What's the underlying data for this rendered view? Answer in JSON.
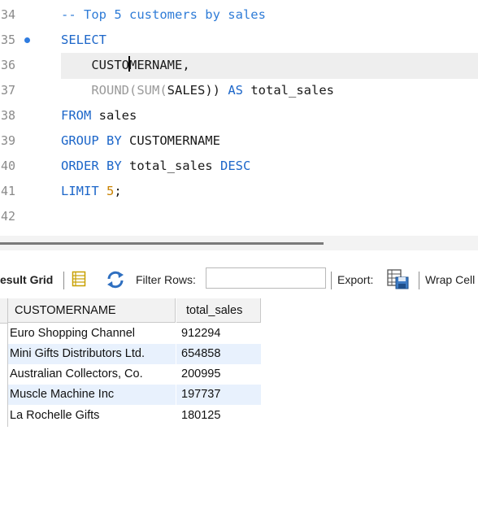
{
  "editor": {
    "lines": [
      {
        "n": "34",
        "tokens": [
          {
            "t": "-- Top 5 customers by sales",
            "c": "cm"
          }
        ]
      },
      {
        "n": "35",
        "bullet": true,
        "tokens": [
          {
            "t": "SELECT",
            "c": "kw"
          }
        ]
      },
      {
        "n": "36",
        "current": true,
        "tokens": [
          {
            "t": "    CUSTO"
          },
          {
            "caret": true
          },
          {
            "t": "MERNAME,"
          }
        ]
      },
      {
        "n": "37",
        "tokens": [
          {
            "t": "    "
          },
          {
            "t": "ROUND(SUM(",
            "c": "fn"
          },
          {
            "t": "SALES"
          },
          {
            "t": "))",
            "c": ""
          },
          {
            "t": " AS ",
            "c": "kw"
          },
          {
            "t": "total_sales"
          }
        ]
      },
      {
        "n": "38",
        "tokens": [
          {
            "t": "FROM",
            "c": "kw"
          },
          {
            "t": " sales"
          }
        ]
      },
      {
        "n": "39",
        "tokens": [
          {
            "t": "GROUP BY",
            "c": "kw"
          },
          {
            "t": " CUSTOMERNAME"
          }
        ]
      },
      {
        "n": "40",
        "tokens": [
          {
            "t": "ORDER BY",
            "c": "kw"
          },
          {
            "t": " total_sales "
          },
          {
            "t": "DESC",
            "c": "kw"
          }
        ]
      },
      {
        "n": "41",
        "tokens": [
          {
            "t": "LIMIT",
            "c": "kw"
          },
          {
            "t": " "
          },
          {
            "t": "5",
            "c": "num"
          },
          {
            "t": ";"
          }
        ]
      },
      {
        "n": "42",
        "tokens": []
      }
    ]
  },
  "toolbar": {
    "result_grid_label": "esult Grid",
    "filter_label": "Filter Rows:",
    "filter_value": "",
    "export_label": "Export:",
    "wrap_label": "Wrap Cell"
  },
  "grid": {
    "columns": [
      "CUSTOMERNAME",
      "total_sales"
    ],
    "rows": [
      [
        "Euro Shopping Channel",
        "912294"
      ],
      [
        "Mini Gifts Distributors Ltd.",
        "654858"
      ],
      [
        "Australian Collectors, Co.",
        "200995"
      ],
      [
        "Muscle Machine Inc",
        "197737"
      ],
      [
        "La Rochelle Gifts",
        "180125"
      ]
    ]
  },
  "colors": {
    "keyword": "#1c66c9",
    "comment": "#2f7cd7",
    "number": "#c98200",
    "function": "#9a9a9a",
    "alt_row": "#e8f1fd"
  }
}
